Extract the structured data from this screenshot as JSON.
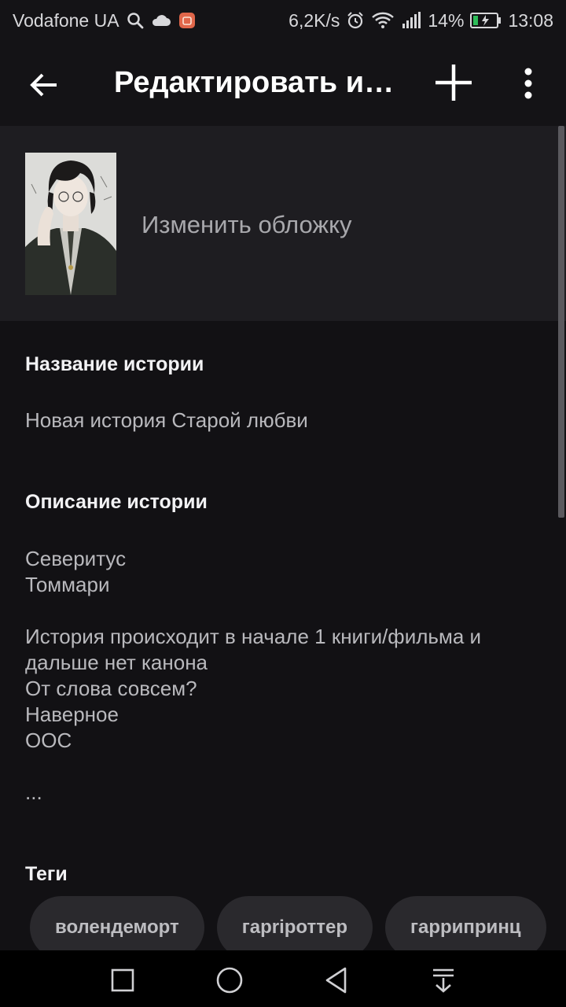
{
  "status_bar": {
    "carrier": "Vodafone UA",
    "speed": "6,2K/s",
    "battery": "14%",
    "time": "13:08",
    "icons": [
      "search-icon",
      "cloud-icon",
      "app-notification-icon",
      "alarm-icon",
      "wifi-icon",
      "signal-icon",
      "battery-charging-icon"
    ]
  },
  "app_bar": {
    "title": "Редактировать и…",
    "icons": [
      "back-arrow-icon",
      "plus-icon",
      "more-vert-icon"
    ]
  },
  "cover": {
    "change_label": "Изменить обложку"
  },
  "story": {
    "title_label": "Название истории",
    "title_value": "Новая история Старой любви",
    "description_label": "Описание истории",
    "description_lines": [
      "Северитус",
      "Томмари",
      "",
      "История происходит в начале 1 книги/фильма и",
      "дальше нет канона",
      "От слова совсем?",
      "Наверное",
      "ООС",
      "",
      "..."
    ],
    "tags_label": "Теги",
    "tags": [
      "волендеморт",
      "гарripоттер",
      "гаррипринц"
    ]
  },
  "nav_bar": {
    "icons": [
      "recent-apps-square-icon",
      "home-circle-icon",
      "back-triangle-icon",
      "notification-pull-icon"
    ]
  },
  "colors": {
    "background": "#121114",
    "cover_section": "#1e1d21",
    "tag_background": "#2a292d",
    "text_primary": "#f2f2f4",
    "text_secondary": "#b9b9bd"
  }
}
